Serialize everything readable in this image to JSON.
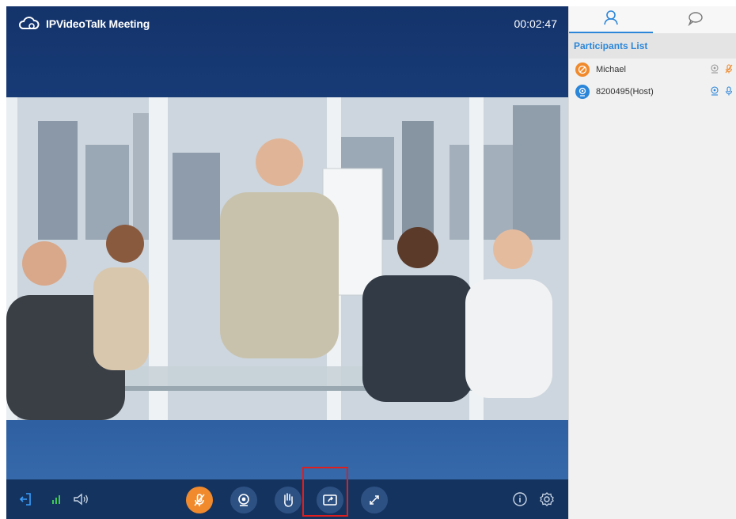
{
  "header": {
    "app_title": "IPVideoTalk Meeting",
    "timer": "00:02:47"
  },
  "sidebar": {
    "tabs": [
      {
        "name": "participants-tab",
        "icon": "person-icon",
        "active": true
      },
      {
        "name": "chat-tab",
        "icon": "chat-bubble-icon",
        "active": false
      }
    ],
    "list_title": "Participants List",
    "participants": [
      {
        "name": "Michael",
        "avatar_color": "#f08a2c",
        "camera": "off",
        "mic": "muted"
      },
      {
        "name": "8200495(Host)",
        "avatar_color": "#2b86d9",
        "camera": "on",
        "mic": "on"
      }
    ]
  },
  "toolbar": {
    "left": [
      "exit-icon",
      "signal-icon",
      "speaker-icon"
    ],
    "center": [
      "mute-mic-button",
      "camera-button",
      "raise-hand-button",
      "share-screen-button",
      "fullscreen-button"
    ],
    "right": [
      "info-icon",
      "settings-icon"
    ],
    "highlighted": "share-screen-button"
  },
  "colors": {
    "header_bg": "#14336b",
    "toolbar_bg": "#15335f",
    "accent_orange": "#f08a2c",
    "accent_blue": "#2b86d9",
    "highlight_red": "#e01e1e",
    "signal_green": "#3ec85a"
  }
}
